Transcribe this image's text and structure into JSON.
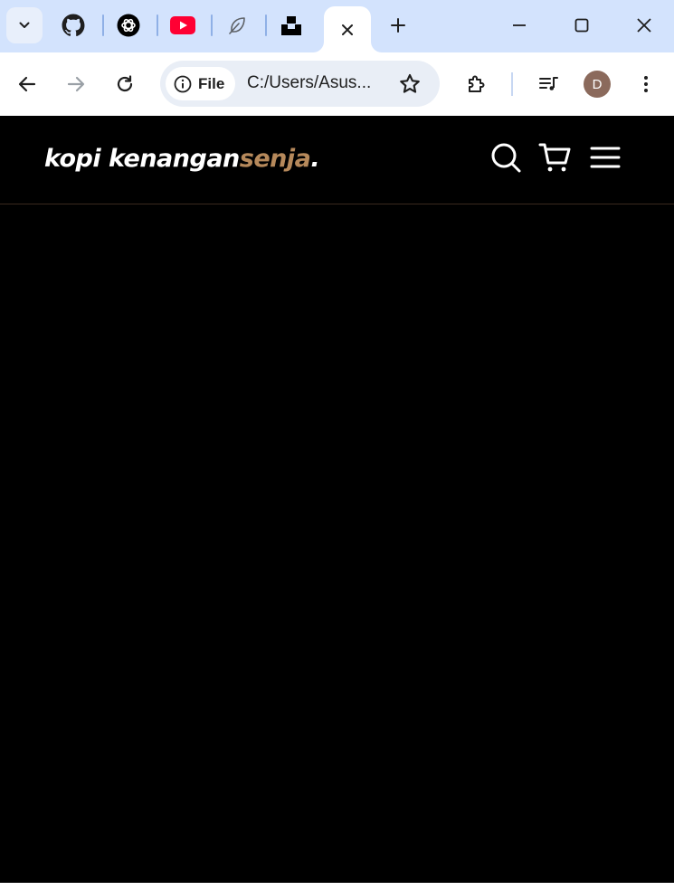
{
  "browser": {
    "tabs": [
      {
        "icon": "github-icon"
      },
      {
        "icon": "chatgpt-icon"
      },
      {
        "icon": "youtube-icon"
      },
      {
        "icon": "feather-icon"
      },
      {
        "icon": "unsplash-icon"
      }
    ],
    "active_tab": {
      "icon": "close-icon"
    },
    "window_controls": [
      "minimize-icon",
      "maximize-icon",
      "close-icon"
    ],
    "address": {
      "scheme_label": "File",
      "url": "C:/Users/Asus..."
    },
    "profile_initial": "D",
    "colors": {
      "tabstrip": "#d3e3fd",
      "youtube": "#ff0033",
      "avatar": "#8b6a5c"
    }
  },
  "site": {
    "logo_main": "kopi kenangan",
    "logo_accent": "senja",
    "logo_dot": ".",
    "nav_icons": [
      "search-icon",
      "shopping-cart-icon",
      "menu-icon"
    ],
    "colors": {
      "background": "#000000",
      "accent": "#b6895b",
      "text": "#ffffff"
    }
  }
}
